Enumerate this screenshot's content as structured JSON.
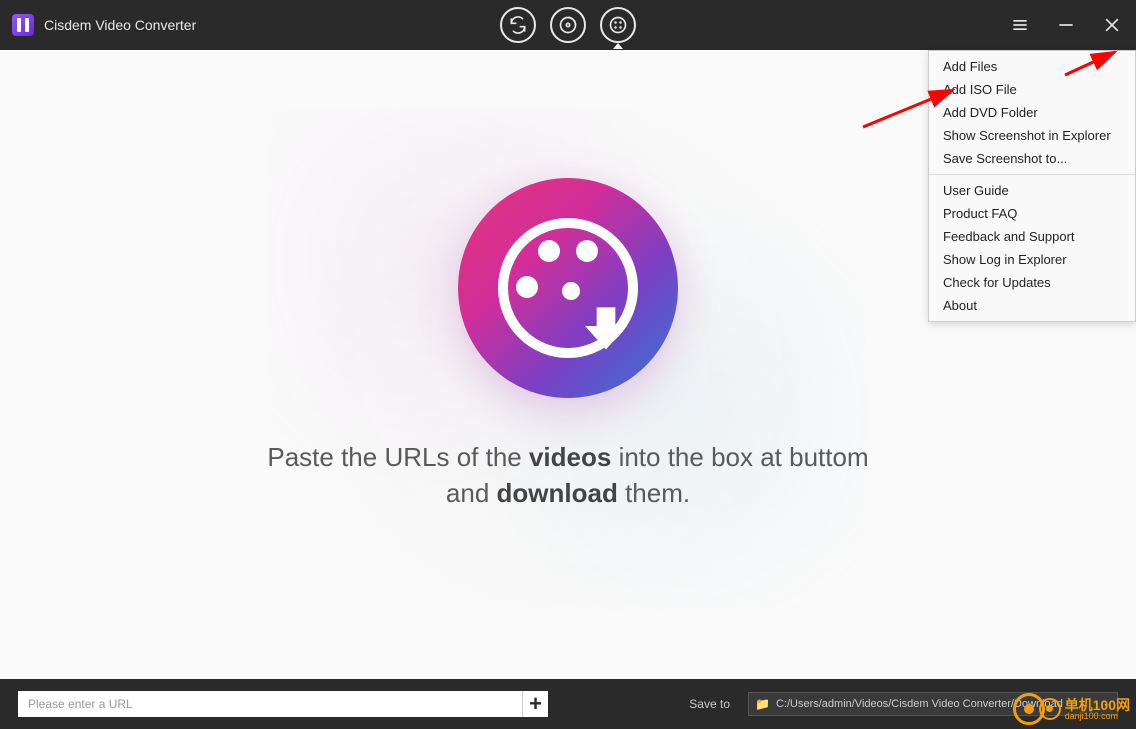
{
  "app": {
    "title": "Cisdem Video Converter"
  },
  "tabs": {
    "convert": "convert",
    "rip": "rip",
    "download": "download",
    "active": "download"
  },
  "tagline": {
    "prefix": "Paste the URLs of the ",
    "bold1": "videos",
    "mid": " into the box at buttom",
    "line2_prefix": "and ",
    "bold2": "download",
    "line2_suffix": " them."
  },
  "urlbar": {
    "placeholder": "Please enter a URL",
    "add_label": "+"
  },
  "saveto": {
    "label": "Save to",
    "path": "C:/Users/admin/Videos/Cisdem Video Converter/Download"
  },
  "menu": {
    "group1": [
      "Add Files",
      "Add ISO File",
      "Add DVD Folder",
      "Show Screenshot in Explorer",
      "Save Screenshot to..."
    ],
    "group2": [
      "User Guide",
      "Product FAQ",
      "Feedback and Support",
      "Show Log in Explorer",
      "Check for Updates",
      "About"
    ]
  },
  "watermark": {
    "cn": "单机100网",
    "url": "danji100.com"
  }
}
